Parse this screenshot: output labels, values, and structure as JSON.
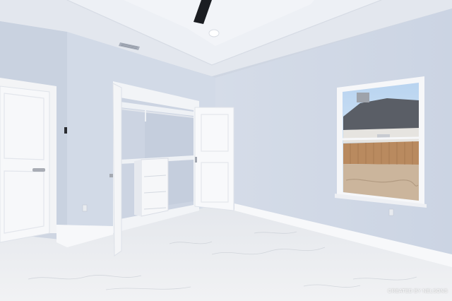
{
  "photo": {
    "subject": "empty-bedroom-interior",
    "watermark_text": "CREATED BY NELSONS",
    "colors": {
      "wall": "#d3dbe8",
      "wall_shadow": "#c4cedd",
      "ceiling": "#e6eaf1",
      "floor": "#eceef1",
      "trim": "#f5f6f8",
      "door": "#f7f8fa",
      "sky": "#cfe3f7",
      "roof": "#5c6068",
      "fence": "#b8865a",
      "ground": "#cdb8a0"
    }
  }
}
